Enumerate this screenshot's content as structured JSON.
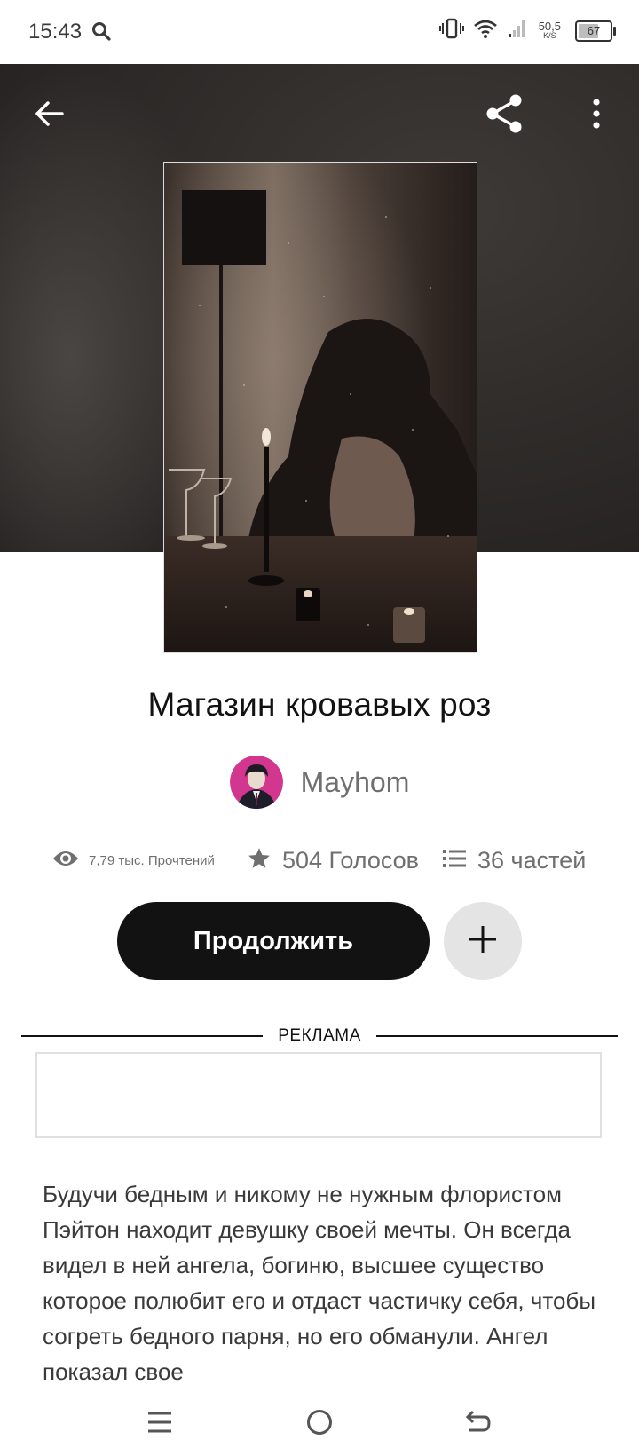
{
  "status_bar": {
    "time": "15:43",
    "net_speed": "50,5",
    "net_unit": "K/S",
    "battery": "67",
    "icons": [
      "search-icon",
      "vibrate-icon",
      "wifi-icon",
      "signal-icon",
      "battery-icon"
    ]
  },
  "header": {
    "icons": [
      "back-arrow-icon",
      "share-icon",
      "more-vertical-icon"
    ]
  },
  "story": {
    "title": "Магазин кровавых роз",
    "author": "Mayhom",
    "stats": {
      "reads": "7,79 тыс. Прочтений",
      "votes": "504 Голосов",
      "parts": "36 частей"
    },
    "continue_label": "Продолжить",
    "description": "Будучи бедным и никому не нужным флористом Пэйтон находит девушку своей мечты. Он всегда видел в ней ангела, богиню, высшее существо которое полюбит его и отдаст частичку себя, чтобы согреть бедного парня, но его обманули. Ангел показал свое"
  },
  "ad": {
    "label": "РЕКЛАМА"
  },
  "nav_bar": {
    "icons": [
      "menu-icon",
      "home-icon",
      "back-icon"
    ]
  },
  "colors": {
    "primary": "#121212",
    "secondary_text": "#6f6f6f",
    "add_button_bg": "#e4e4e4",
    "header_bg": "#2f2c2a"
  }
}
